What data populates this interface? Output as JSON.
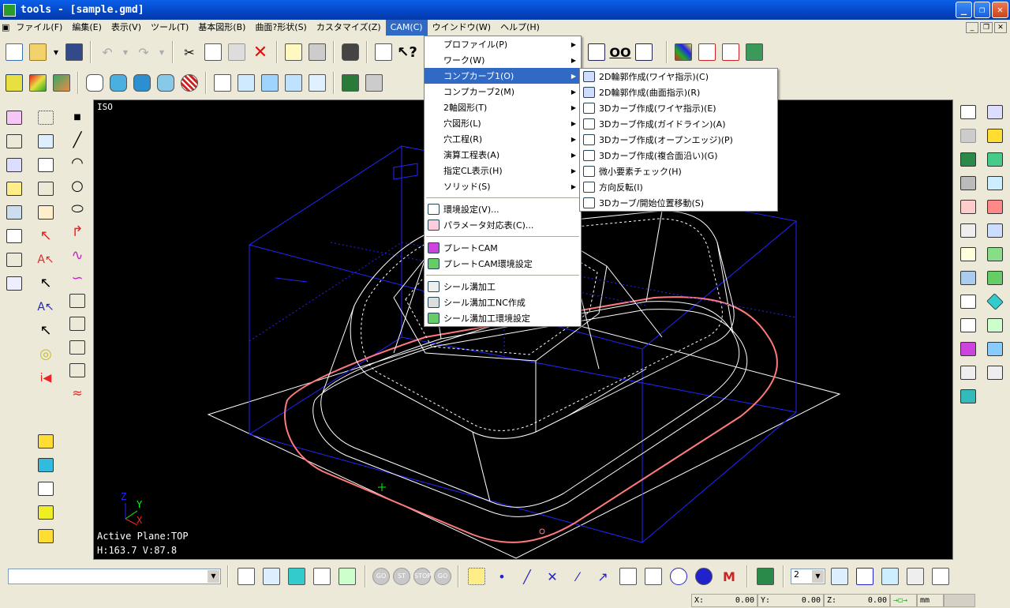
{
  "window": {
    "title": "tools - [sample.gmd]",
    "min_label": "_",
    "max_label": "❐",
    "close_label": "✕"
  },
  "menubar": {
    "items": [
      "ファイル(F)",
      "編集(E)",
      "表示(V)",
      "ツール(T)",
      "基本図形(B)",
      "曲面?形状(S)",
      "カスタマイズ(Z)",
      "CAM(C)",
      "ウインドウ(W)",
      "ヘルプ(H)"
    ],
    "active_index": 7
  },
  "cam_menu": {
    "items": [
      {
        "label": "プロファイル(P)",
        "submenu": true
      },
      {
        "label": "ワーク(W)",
        "submenu": true
      },
      {
        "label": "コンプカーブ1(O)",
        "submenu": true,
        "highlight": true
      },
      {
        "label": "コンプカーブ2(M)",
        "submenu": true
      },
      {
        "label": "2軸図形(T)",
        "submenu": true
      },
      {
        "label": "穴図形(L)",
        "submenu": true
      },
      {
        "label": "穴工程(R)",
        "submenu": true
      },
      {
        "label": "演算工程表(A)",
        "submenu": true
      },
      {
        "label": "指定CL表示(H)",
        "submenu": true
      },
      {
        "label": "ソリッド(S)",
        "submenu": true
      }
    ],
    "group2": [
      "環境設定(V)...",
      "パラメータ対応表(C)..."
    ],
    "group3": [
      "プレートCAM",
      "プレートCAM環境設定"
    ],
    "group4": [
      "シール溝加工",
      "シール溝加工NC作成",
      "シール溝加工環境設定"
    ]
  },
  "submenu": {
    "items": [
      "2D輪郭作成(ワイヤ指示)(C)",
      "2D輪郭作成(曲面指示)(R)",
      "3Dカーブ作成(ワイヤ指示)(E)",
      "3Dカーブ作成(ガイドライン)(A)",
      "3Dカーブ作成(オープンエッジ)(P)",
      "3Dカーブ作成(複合面沿い)(G)",
      "微小要素チェック(H)",
      "方向反転(I)",
      "3Dカーブ/開始位置移動(S)"
    ]
  },
  "viewport": {
    "view_label": "ISO",
    "active_plane": "Active Plane:TOP",
    "hv": "H:163.7 V:87.8",
    "axis_z": "Z",
    "axis_y": "Y",
    "axis_x": "X"
  },
  "bottom": {
    "combo_value": "",
    "go_labels": [
      "GO",
      "ST",
      "STOP",
      "GO"
    ],
    "layer_value": "2"
  },
  "statusbar": {
    "x_label": "X:",
    "x_value": "0.00",
    "y_label": "Y:",
    "y_value": "0.00",
    "z_label": "Z:",
    "z_value": "0.00",
    "unit": "mm"
  },
  "colors": {
    "highlight": "#316ac5",
    "wire": "#ffffff",
    "box": "#1a1aff",
    "toolpath": "#ff7a7a"
  }
}
